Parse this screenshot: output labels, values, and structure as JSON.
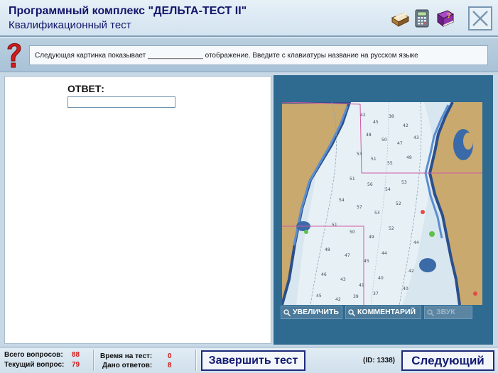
{
  "header": {
    "title": "Программный комплекс \"ДЕЛЬТА-ТЕСТ II\"",
    "subtitle": "Квалификационный тест"
  },
  "toolbar_icons": [
    "card-index-icon",
    "calculator-icon",
    "help-book-icon",
    "close-icon"
  ],
  "question": {
    "text": "Следующая картинка показывает ______________ отображение. Введите с клавиатуры название на русском языке"
  },
  "answer": {
    "label": "ОТВЕТ:",
    "value": "",
    "placeholder": ""
  },
  "image_panel": {
    "content": "nautical-chart",
    "buttons": [
      {
        "label": "УВЕЛИЧИТЬ",
        "enabled": true
      },
      {
        "label": "КОММЕНТАРИЙ",
        "enabled": true
      },
      {
        "label": "ЗВУК",
        "enabled": false
      }
    ]
  },
  "footer": {
    "total_questions_label": "Всего вопросов:",
    "total_questions": "88",
    "current_question_label": "Текущий вопрос:",
    "current_question": "79",
    "time_label": "Время на тест:",
    "time_value": "0",
    "answers_label": "Дано ответов:",
    "answers_value": "8",
    "finish_button": "Завершить тест",
    "question_id": "(ID: 1338)",
    "next_button": "Следующий"
  },
  "colors": {
    "title": "#13166b",
    "stat_value": "#d01a1a",
    "land": "#c9a96e",
    "deep_water": "#2f6a91"
  }
}
